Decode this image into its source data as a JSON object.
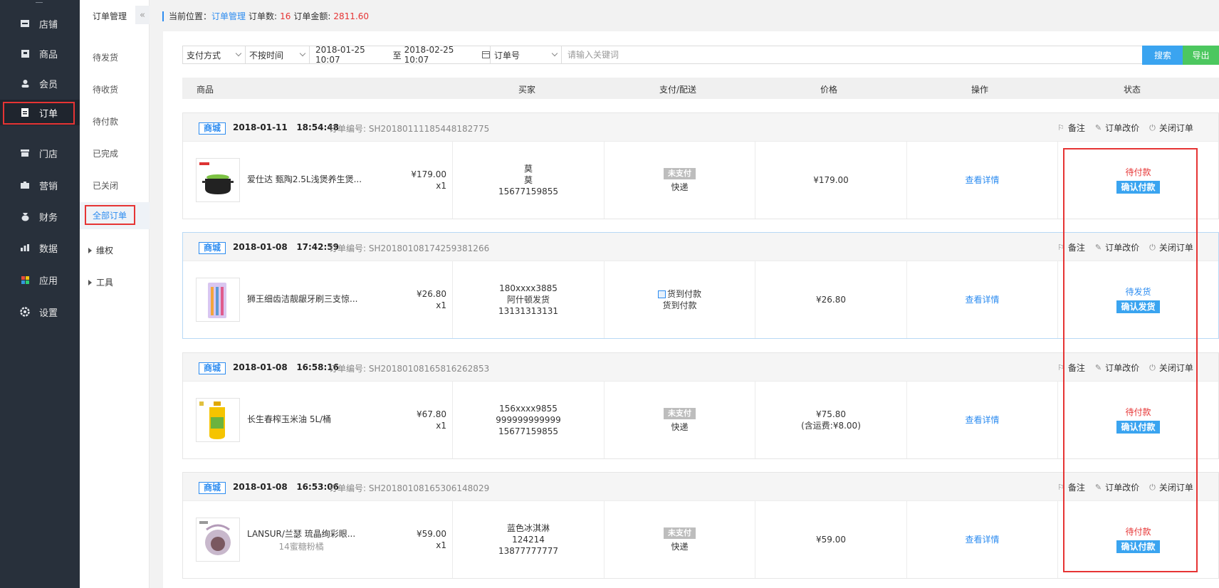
{
  "sidebar": {
    "items": [
      {
        "label": "店铺",
        "icon": "store-icon"
      },
      {
        "label": "商品",
        "icon": "product-icon"
      },
      {
        "label": "会员",
        "icon": "user-icon"
      },
      {
        "label": "订单",
        "icon": "order-icon"
      },
      {
        "label": "门店",
        "icon": "shop-icon"
      },
      {
        "label": "营销",
        "icon": "marketing-icon"
      },
      {
        "label": "财务",
        "icon": "finance-icon"
      },
      {
        "label": "数据",
        "icon": "data-icon"
      },
      {
        "label": "应用",
        "icon": "apps-icon"
      },
      {
        "label": "设置",
        "icon": "gear-icon"
      }
    ],
    "active": "订单"
  },
  "subnav": {
    "title": "订单管理",
    "collapse": "«",
    "items": [
      "待发货",
      "待收货",
      "待付款",
      "已完成",
      "已关闭",
      "全部订单"
    ],
    "groups": [
      "维权",
      "工具"
    ]
  },
  "breadcrumb": {
    "prefix": "当前位置：",
    "current": "订单管理",
    "count_label": "订单数:",
    "count": "16",
    "amount_label": "订单金额:",
    "amount": "2811.60"
  },
  "filter": {
    "pay_method": "支付方式",
    "time_mode": "不按时间",
    "date_start": "2018-01-25 10:07",
    "date_sep": "至",
    "date_end": "2018-02-25 10:07",
    "search_field": "订单号",
    "keyword_placeholder": "请输入关键词",
    "search_button": "搜索",
    "export_button": "导出"
  },
  "table": {
    "headers": [
      "商品",
      "买家",
      "支付/配送",
      "价格",
      "操作",
      "状态"
    ]
  },
  "order_actions": [
    "备注",
    "订单改价",
    "关闭订单"
  ],
  "orders": [
    {
      "tag": "商城",
      "date": "2018-01-11",
      "time": "18:54:48",
      "no_label": "订单编号:",
      "no": "SH20180111185448182775",
      "product": "爱仕达 甄陶2.5L浅煲养生煲...",
      "sku": "",
      "unit_price": "¥179.00",
      "qty": "x1",
      "buyer": [
        "莫",
        "莫",
        "15677159855"
      ],
      "pay_badge": "未支付",
      "pay_cod": "",
      "delivery": "快递",
      "price": "¥179.00",
      "price_note": "",
      "op": "查看详情",
      "status": "待付款",
      "status_btn": "确认付款",
      "status_color": "red"
    },
    {
      "tag": "商城",
      "date": "2018-01-08",
      "time": "17:42:59",
      "no_label": "订单编号:",
      "no": "SH20180108174259381266",
      "product": "狮王细齿洁靓龈牙刷三支惊...",
      "sku": "",
      "unit_price": "¥26.80",
      "qty": "x1",
      "buyer": [
        "180xxxx3885",
        "阿什顿发货",
        "13131313131"
      ],
      "pay_badge": "",
      "pay_cod": "货到付款",
      "delivery": "货到付款",
      "price": "¥26.80",
      "price_note": "",
      "op": "查看详情",
      "status": "待发货",
      "status_btn": "确认发货",
      "status_color": "blue"
    },
    {
      "tag": "商城",
      "date": "2018-01-08",
      "time": "16:58:16",
      "no_label": "订单编号:",
      "no": "SH20180108165816262853",
      "product": "长生春榨玉米油 5L/桶",
      "sku": "",
      "unit_price": "¥67.80",
      "qty": "x1",
      "buyer": [
        "156xxxx9855",
        "999999999999",
        "15677159855"
      ],
      "pay_badge": "未支付",
      "pay_cod": "",
      "delivery": "快递",
      "price": "¥75.80",
      "price_note": "(含运费:¥8.00)",
      "op": "查看详情",
      "status": "待付款",
      "status_btn": "确认付款",
      "status_color": "red"
    },
    {
      "tag": "商城",
      "date": "2018-01-08",
      "time": "16:53:06",
      "no_label": "订单编号:",
      "no": "SH20180108165306148029",
      "product": "LANSUR/兰瑟 琉晶绚彩眼...",
      "sku": "14蜜糖粉橘",
      "unit_price": "¥59.00",
      "qty": "x1",
      "buyer": [
        "蓝色冰淇淋",
        "124214",
        "13877777777"
      ],
      "pay_badge": "未支付",
      "pay_cod": "",
      "delivery": "快递",
      "price": "¥59.00",
      "price_note": "",
      "op": "查看详情",
      "status": "待付款",
      "status_btn": "确认付款",
      "status_color": "red"
    }
  ]
}
